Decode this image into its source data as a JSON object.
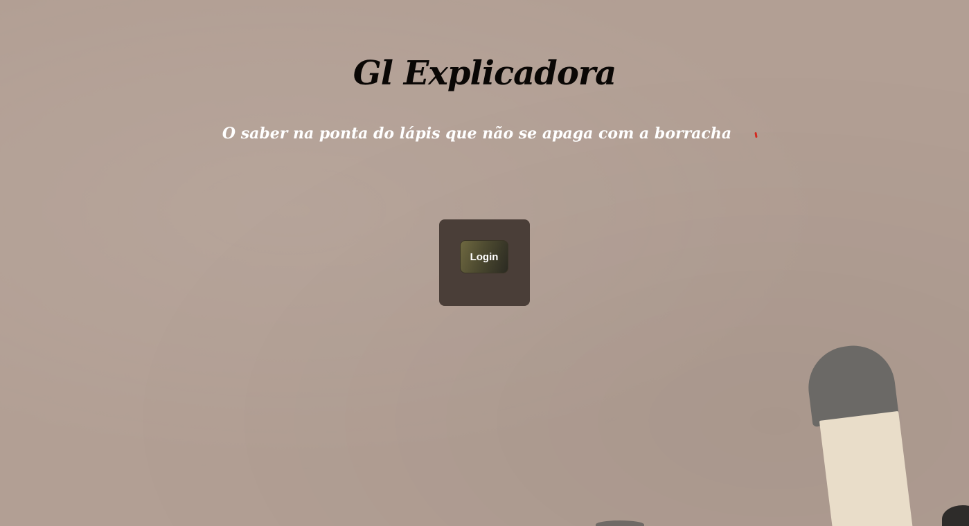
{
  "header": {
    "title": "Gl Explicadora",
    "subtitle": "O saber na ponta do lápis que não se apaga com a borracha"
  },
  "login": {
    "button_label": "Login"
  },
  "colors": {
    "background": "#b29f94",
    "title": "#0a0705",
    "subtitle": "#ffffff",
    "card": "#4a3e38",
    "button_gradient_start": "#6e6840",
    "button_gradient_end": "#2b2a22",
    "accent_mark": "#d42a20"
  },
  "decorations": [
    "pencil-eraser-image",
    "red-mark"
  ]
}
